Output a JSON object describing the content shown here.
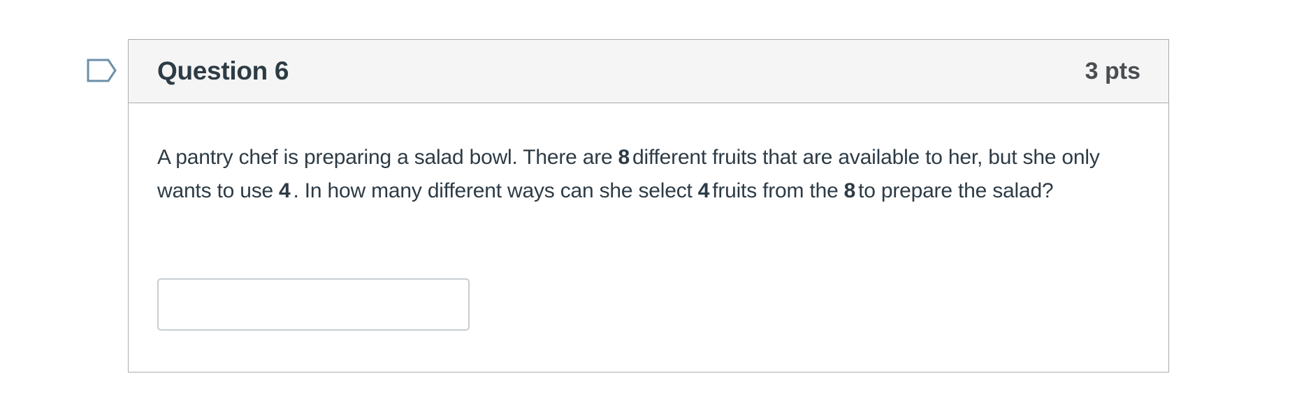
{
  "flag": {
    "icon": "flag-bookmark-icon",
    "color": "#6b8fa8"
  },
  "question": {
    "title": "Question 6",
    "points": "3 pts",
    "body": {
      "t1": "A pantry chef is preparing a salad bowl. There are",
      "n1": "8",
      "t2": "different fruits that are available to her, but she only wants to use",
      "n2": "4",
      "t3": ". In how many different ways can she select",
      "n3": "4",
      "t4": "fruits from the",
      "n4": "8",
      "t5": "to prepare the salad?"
    },
    "answer": {
      "value": "",
      "placeholder": ""
    }
  },
  "colors": {
    "text": "#2d3b45",
    "points_text": "#4a4e52",
    "border": "#a8abad",
    "header_bg": "#f5f5f5",
    "input_border": "#c7cdd1"
  }
}
